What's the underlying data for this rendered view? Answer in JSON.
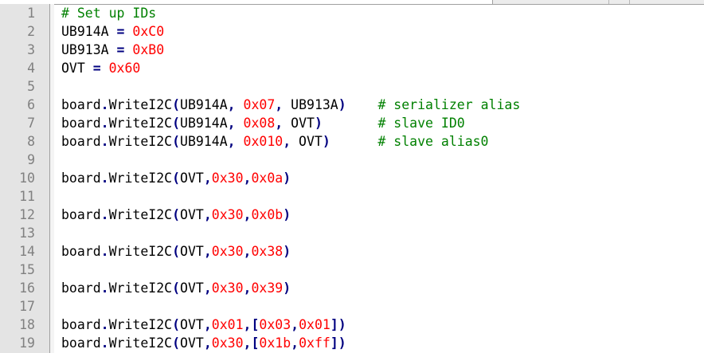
{
  "editor": {
    "colors": {
      "plain": "#000000",
      "operator": "#000080",
      "number": "#ff0000",
      "comment": "#008000",
      "line_number": "#808080",
      "gutter": "#e4e4e4"
    },
    "lines": [
      {
        "number": "1",
        "tokens": [
          {
            "type": "comment",
            "text": "# Set up IDs"
          }
        ]
      },
      {
        "number": "2",
        "tokens": [
          {
            "type": "plain",
            "text": "UB914A "
          },
          {
            "type": "op",
            "text": "="
          },
          {
            "type": "plain",
            "text": " "
          },
          {
            "type": "num",
            "text": "0xC0"
          }
        ]
      },
      {
        "number": "3",
        "tokens": [
          {
            "type": "plain",
            "text": "UB913A "
          },
          {
            "type": "op",
            "text": "="
          },
          {
            "type": "plain",
            "text": " "
          },
          {
            "type": "num",
            "text": "0xB0"
          }
        ]
      },
      {
        "number": "4",
        "tokens": [
          {
            "type": "plain",
            "text": "OVT "
          },
          {
            "type": "op",
            "text": "="
          },
          {
            "type": "plain",
            "text": " "
          },
          {
            "type": "num",
            "text": "0x60"
          }
        ]
      },
      {
        "number": "5",
        "tokens": []
      },
      {
        "number": "6",
        "tokens": [
          {
            "type": "plain",
            "text": "board"
          },
          {
            "type": "op",
            "text": "."
          },
          {
            "type": "plain",
            "text": "WriteI2C"
          },
          {
            "type": "op",
            "text": "("
          },
          {
            "type": "plain",
            "text": "UB914A"
          },
          {
            "type": "op",
            "text": ","
          },
          {
            "type": "plain",
            "text": " "
          },
          {
            "type": "num",
            "text": "0x07"
          },
          {
            "type": "op",
            "text": ","
          },
          {
            "type": "plain",
            "text": " UB913A"
          },
          {
            "type": "op",
            "text": ")"
          },
          {
            "type": "plain",
            "text": "    "
          },
          {
            "type": "comment",
            "text": "# serializer alias"
          }
        ]
      },
      {
        "number": "7",
        "tokens": [
          {
            "type": "plain",
            "text": "board"
          },
          {
            "type": "op",
            "text": "."
          },
          {
            "type": "plain",
            "text": "WriteI2C"
          },
          {
            "type": "op",
            "text": "("
          },
          {
            "type": "plain",
            "text": "UB914A"
          },
          {
            "type": "op",
            "text": ","
          },
          {
            "type": "plain",
            "text": " "
          },
          {
            "type": "num",
            "text": "0x08"
          },
          {
            "type": "op",
            "text": ","
          },
          {
            "type": "plain",
            "text": " OVT"
          },
          {
            "type": "op",
            "text": ")"
          },
          {
            "type": "plain",
            "text": "       "
          },
          {
            "type": "comment",
            "text": "# slave ID0"
          }
        ]
      },
      {
        "number": "8",
        "tokens": [
          {
            "type": "plain",
            "text": "board"
          },
          {
            "type": "op",
            "text": "."
          },
          {
            "type": "plain",
            "text": "WriteI2C"
          },
          {
            "type": "op",
            "text": "("
          },
          {
            "type": "plain",
            "text": "UB914A"
          },
          {
            "type": "op",
            "text": ","
          },
          {
            "type": "plain",
            "text": " "
          },
          {
            "type": "num",
            "text": "0x010"
          },
          {
            "type": "op",
            "text": ","
          },
          {
            "type": "plain",
            "text": " OVT"
          },
          {
            "type": "op",
            "text": ")"
          },
          {
            "type": "plain",
            "text": "      "
          },
          {
            "type": "comment",
            "text": "# slave alias0"
          }
        ]
      },
      {
        "number": "9",
        "tokens": []
      },
      {
        "number": "10",
        "tokens": [
          {
            "type": "plain",
            "text": "board"
          },
          {
            "type": "op",
            "text": "."
          },
          {
            "type": "plain",
            "text": "WriteI2C"
          },
          {
            "type": "op",
            "text": "("
          },
          {
            "type": "plain",
            "text": "OVT"
          },
          {
            "type": "op",
            "text": ","
          },
          {
            "type": "num",
            "text": "0x30"
          },
          {
            "type": "op",
            "text": ","
          },
          {
            "type": "num",
            "text": "0x0a"
          },
          {
            "type": "op",
            "text": ")"
          }
        ]
      },
      {
        "number": "11",
        "tokens": []
      },
      {
        "number": "12",
        "tokens": [
          {
            "type": "plain",
            "text": "board"
          },
          {
            "type": "op",
            "text": "."
          },
          {
            "type": "plain",
            "text": "WriteI2C"
          },
          {
            "type": "op",
            "text": "("
          },
          {
            "type": "plain",
            "text": "OVT"
          },
          {
            "type": "op",
            "text": ","
          },
          {
            "type": "num",
            "text": "0x30"
          },
          {
            "type": "op",
            "text": ","
          },
          {
            "type": "num",
            "text": "0x0b"
          },
          {
            "type": "op",
            "text": ")"
          }
        ]
      },
      {
        "number": "13",
        "tokens": []
      },
      {
        "number": "14",
        "tokens": [
          {
            "type": "plain",
            "text": "board"
          },
          {
            "type": "op",
            "text": "."
          },
          {
            "type": "plain",
            "text": "WriteI2C"
          },
          {
            "type": "op",
            "text": "("
          },
          {
            "type": "plain",
            "text": "OVT"
          },
          {
            "type": "op",
            "text": ","
          },
          {
            "type": "num",
            "text": "0x30"
          },
          {
            "type": "op",
            "text": ","
          },
          {
            "type": "num",
            "text": "0x38"
          },
          {
            "type": "op",
            "text": ")"
          }
        ]
      },
      {
        "number": "15",
        "tokens": []
      },
      {
        "number": "16",
        "tokens": [
          {
            "type": "plain",
            "text": "board"
          },
          {
            "type": "op",
            "text": "."
          },
          {
            "type": "plain",
            "text": "WriteI2C"
          },
          {
            "type": "op",
            "text": "("
          },
          {
            "type": "plain",
            "text": "OVT"
          },
          {
            "type": "op",
            "text": ","
          },
          {
            "type": "num",
            "text": "0x30"
          },
          {
            "type": "op",
            "text": ","
          },
          {
            "type": "num",
            "text": "0x39"
          },
          {
            "type": "op",
            "text": ")"
          }
        ]
      },
      {
        "number": "17",
        "tokens": []
      },
      {
        "number": "18",
        "tokens": [
          {
            "type": "plain",
            "text": "board"
          },
          {
            "type": "op",
            "text": "."
          },
          {
            "type": "plain",
            "text": "WriteI2C"
          },
          {
            "type": "op",
            "text": "("
          },
          {
            "type": "plain",
            "text": "OVT"
          },
          {
            "type": "op",
            "text": ","
          },
          {
            "type": "num",
            "text": "0x01"
          },
          {
            "type": "op",
            "text": ",["
          },
          {
            "type": "num",
            "text": "0x03"
          },
          {
            "type": "op",
            "text": ","
          },
          {
            "type": "num",
            "text": "0x01"
          },
          {
            "type": "op",
            "text": "])"
          }
        ]
      },
      {
        "number": "19",
        "tokens": [
          {
            "type": "plain",
            "text": "board"
          },
          {
            "type": "op",
            "text": "."
          },
          {
            "type": "plain",
            "text": "WriteI2C"
          },
          {
            "type": "op",
            "text": "("
          },
          {
            "type": "plain",
            "text": "OVT"
          },
          {
            "type": "op",
            "text": ","
          },
          {
            "type": "num",
            "text": "0x30"
          },
          {
            "type": "op",
            "text": ",["
          },
          {
            "type": "num",
            "text": "0x1b"
          },
          {
            "type": "op",
            "text": ","
          },
          {
            "type": "num",
            "text": "0xff"
          },
          {
            "type": "op",
            "text": "])"
          }
        ]
      }
    ]
  }
}
